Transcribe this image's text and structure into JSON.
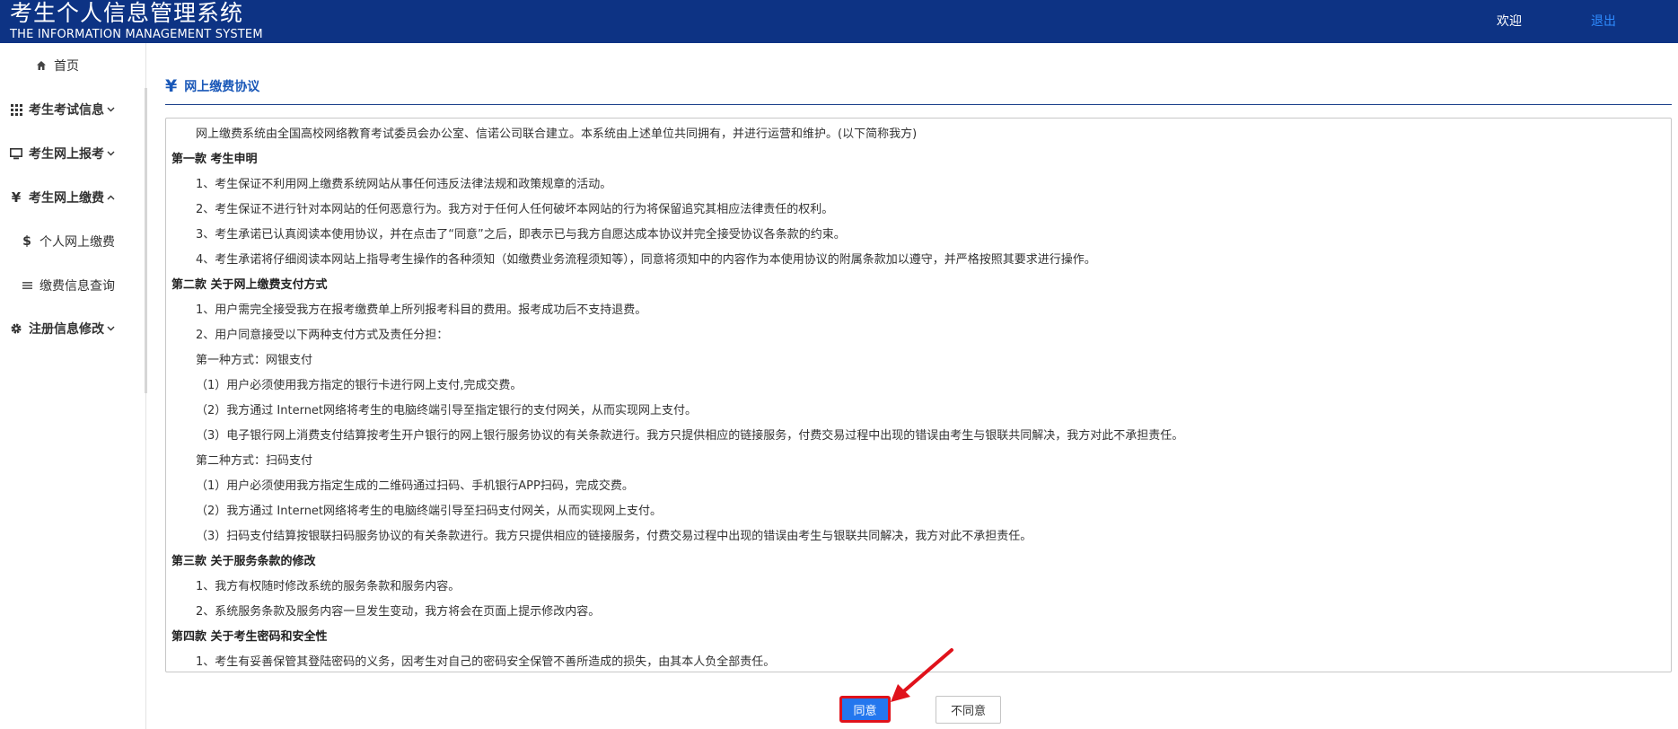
{
  "header": {
    "title": "考生个人信息管理系统",
    "subtitle": "THE INFORMATION MANAGEMENT SYSTEM",
    "welcome": "欢迎",
    "logout": "退出"
  },
  "sidebar": {
    "items": [
      {
        "label": "首页",
        "icon": "home-icon"
      },
      {
        "label": "考生考试信息",
        "icon": "grid-icon",
        "expanded": false
      },
      {
        "label": "考生网上报考",
        "icon": "monitor-icon",
        "expanded": false
      },
      {
        "label": "考生网上缴费",
        "icon": "yen-icon",
        "expanded": true
      },
      {
        "label": "个人网上缴费",
        "icon": "dollar-icon"
      },
      {
        "label": "缴费信息查询",
        "icon": "list-icon"
      },
      {
        "label": "注册信息修改",
        "icon": "gear-icon",
        "expanded": false
      }
    ]
  },
  "main": {
    "section_title": "网上缴费协议",
    "section_icon": "yen-icon",
    "agreement_lines": [
      "网上缴费系统由全国高校网络教育考试委员会办公室、信诺公司联合建立。本系统由上述单位共同拥有，并进行运营和维护。(以下简称我方)",
      "第一款 考生申明",
      "1、考生保证不利用网上缴费系统网站从事任何违反法律法规和政策规章的活动。",
      "2、考生保证不进行针对本网站的任何恶意行为。我方对于任何人任何破坏本网站的行为将保留追究其相应法律责任的权利。",
      "3、考生承诺已认真阅读本使用协议，并在点击了“同意”之后，即表示已与我方自愿达成本协议并完全接受协议各条款的约束。",
      "4、考生承诺将仔细阅读本网站上指导考生操作的各种须知（如缴费业务流程须知等），同意将须知中的内容作为本使用协议的附属条款加以遵守，并严格按照其要求进行操作。",
      "第二款 关于网上缴费支付方式",
      "1、用户需完全接受我方在报考缴费单上所列报考科目的费用。报考成功后不支持退费。",
      "2、用户同意接受以下两种支付方式及责任分担：",
      "第一种方式：网银支付",
      "（1）用户必须使用我方指定的银行卡进行网上支付,完成交费。",
      "（2）我方通过 Internet网络将考生的电脑终端引导至指定银行的支付网关，从而实现网上支付。",
      "（3）电子银行网上消费支付结算按考生开户银行的网上银行服务协议的有关条款进行。我方只提供相应的链接服务，付费交易过程中出现的错误由考生与银联共同解决，我方对此不承担责任。",
      "第二种方式：扫码支付",
      "（1）用户必须使用我方指定生成的二维码通过扫码、手机银行APP扫码，完成交费。",
      "（2）我方通过 Internet网络将考生的电脑终端引导至扫码支付网关，从而实现网上支付。",
      "（3）扫码支付结算按银联扫码服务协议的有关条款进行。我方只提供相应的链接服务，付费交易过程中出现的错误由考生与银联共同解决，我方对此不承担责任。",
      "第三款 关于服务条款的修改",
      "1、我方有权随时修改系统的服务条款和服务内容。",
      "2、系统服务条款及服务内容一旦发生变动，我方将会在页面上提示修改内容。",
      "第四款 关于考生密码和安全性",
      "1、考生有妥善保管其登陆密码的义务，因考生对自己的密码安全保管不善所造成的损失，由其本人负全部责任。"
    ],
    "agree_button": "同意",
    "disagree_button": "不同意"
  },
  "colors": {
    "header_bg": "#0d3384",
    "accent": "#1a58b8",
    "agree_bg": "#2477ee",
    "highlight": "#e0121b"
  }
}
